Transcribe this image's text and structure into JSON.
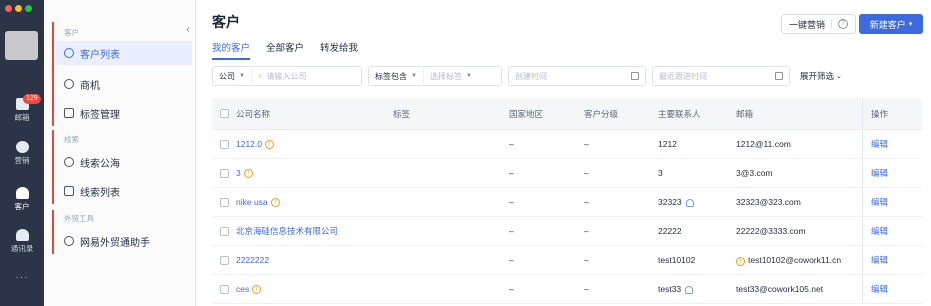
{
  "rail": {
    "badge": "129",
    "items": [
      {
        "label": "邮箱",
        "icon": "mail-icon"
      },
      {
        "label": "营销",
        "icon": "pie-chart-icon"
      },
      {
        "label": "客户",
        "icon": "customer-icon"
      },
      {
        "label": "通讯录",
        "icon": "contacts-icon"
      }
    ],
    "more": "···"
  },
  "subnav": {
    "section_customer": "客户",
    "customer_list": "客户列表",
    "opportunity": "商机",
    "tag_manage": "标签管理",
    "section_leads": "线索",
    "lead_pool": "线索公海",
    "lead_list": "线索列表",
    "section_tools": "外贸工具",
    "trade_assistant": "网易外贸通助手",
    "collapse": "‹"
  },
  "header": {
    "title": "客户",
    "tabs": [
      "我的客户",
      "全部客户",
      "转发给我"
    ],
    "marketing_button": "一键营销",
    "help": "?",
    "new_button": "新建客户",
    "new_caret": "▾"
  },
  "filters": {
    "company_select": "公司",
    "company_placeholder": "请输入公司",
    "tag_select": "标签包含",
    "tag_placeholder": "选择标签",
    "created_placeholder": "创建时间",
    "followup_placeholder": "最近跟进时间",
    "expand": "展开筛选"
  },
  "table": {
    "columns": [
      "公司名称",
      "标签",
      "国家地区",
      "客户分级",
      "主要联系人",
      "邮箱",
      "操作"
    ],
    "rows": [
      {
        "name": "1212.0",
        "tag": "",
        "country": "–",
        "level": "–",
        "contact": "1212",
        "email": "1212@11.com",
        "email_warn": false,
        "contact_icon": false,
        "op": "编辑"
      },
      {
        "name": "3",
        "tag": "",
        "country": "–",
        "level": "–",
        "contact": "3",
        "email": "3@3.com",
        "email_warn": false,
        "contact_icon": false,
        "op": "编辑"
      },
      {
        "name": "nike usa",
        "tag": "",
        "country": "–",
        "level": "–",
        "contact": "32323",
        "email": "32323@323.com",
        "email_warn": false,
        "contact_icon": true,
        "op": "编辑"
      },
      {
        "name": "北京海硅信息技术有限公司",
        "tag": "",
        "country": "–",
        "level": "–",
        "contact": "22222",
        "email": "22222@3333.com",
        "email_warn": false,
        "contact_icon": false,
        "op": "编辑",
        "no_warn": true
      },
      {
        "name": "2222222",
        "tag": "",
        "country": "–",
        "level": "–",
        "contact": "test10102",
        "email": "test10102@cowork11.cn",
        "email_warn": true,
        "contact_icon": false,
        "op": "编辑",
        "no_warn": true
      },
      {
        "name": "ces",
        "tag": "",
        "country": "–",
        "level": "–",
        "contact": "test33",
        "email": "test33@cowork105.net",
        "email_warn": false,
        "contact_icon": true,
        "op": "编辑"
      }
    ]
  },
  "colors": {
    "accent": "#3d6bdc",
    "rail": "#2b3547",
    "highlight_bar": "#e2473c",
    "warn": "#f0a020"
  }
}
